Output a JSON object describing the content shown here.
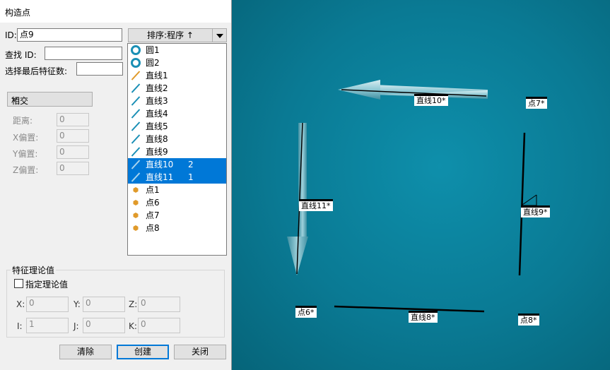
{
  "dialog": {
    "title": "构造点",
    "id_label": "ID:",
    "id_value": "点9",
    "find_label": "查找 ID:",
    "find_value": "",
    "select_last_label": "选择最后特征数:",
    "select_last_value": "",
    "method": "相交",
    "distance_label": "距离:",
    "distance_value": "0",
    "xoff_label": "X偏置:",
    "xoff_value": "0",
    "yoff_label": "Y偏置:",
    "yoff_value": "0",
    "zoff_label": "Z偏置:",
    "zoff_value": "0",
    "sort_label": "排序:程序 ↑",
    "features": [
      {
        "label": "圆1",
        "type": "circle",
        "order": ""
      },
      {
        "label": "圆2",
        "type": "circle",
        "order": ""
      },
      {
        "label": "直线1",
        "type": "line-orange",
        "order": ""
      },
      {
        "label": "直线2",
        "type": "line",
        "order": ""
      },
      {
        "label": "直线3",
        "type": "line",
        "order": ""
      },
      {
        "label": "直线4",
        "type": "line",
        "order": ""
      },
      {
        "label": "直线5",
        "type": "line",
        "order": ""
      },
      {
        "label": "直线8",
        "type": "line",
        "order": ""
      },
      {
        "label": "直线9",
        "type": "line",
        "order": ""
      },
      {
        "label": "直线10",
        "type": "line",
        "order": "2",
        "selected": true
      },
      {
        "label": "直线11",
        "type": "line",
        "order": "1",
        "selected": true
      },
      {
        "label": "点1",
        "type": "point",
        "order": ""
      },
      {
        "label": "点6",
        "type": "point",
        "order": ""
      },
      {
        "label": "点7",
        "type": "point",
        "order": ""
      },
      {
        "label": "点8",
        "type": "point",
        "order": ""
      }
    ],
    "nominal_group_title": "特征理论值",
    "specify_nominal_label": "指定理论值",
    "x_label": "X:",
    "x_value": "0",
    "y_label": "Y:",
    "y_value": "0",
    "z_label": "Z:",
    "z_value": "0",
    "i_label": "I:",
    "i_value": "1",
    "j_label": "J:",
    "j_value": "0",
    "k_label": "K:",
    "k_value": "0",
    "clear_button": "清除",
    "create_button": "创建",
    "close_button": "关闭"
  },
  "viewport": {
    "labels": {
      "line10": "直线10*",
      "line11": "直线11*",
      "line8": "直线8*",
      "line9": "直线9*",
      "point6": "点6*",
      "point7": "点7*",
      "point8": "点8*"
    }
  },
  "colors": {
    "viewport_bg": "#0b7e98",
    "selection": "#0078d7",
    "line_icon": "#1a8fb5",
    "line1_icon": "#e09a2a",
    "point_icon": "#e09a2a"
  }
}
